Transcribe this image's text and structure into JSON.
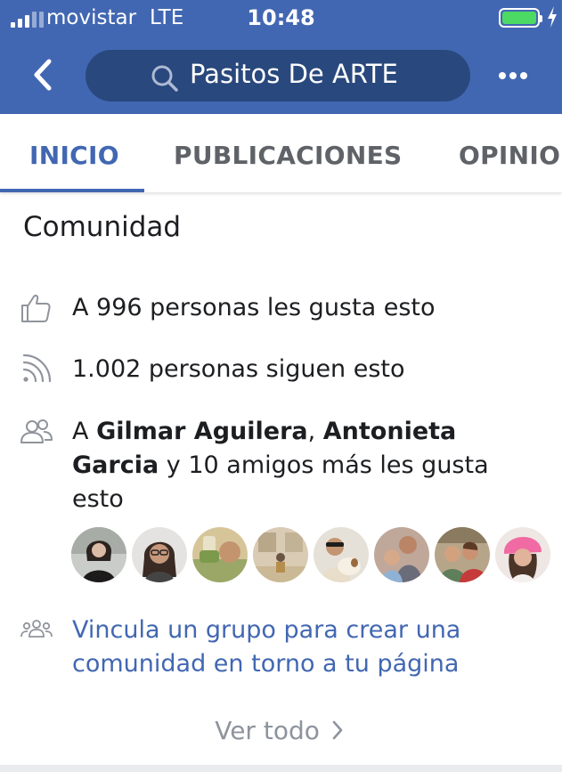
{
  "status_bar": {
    "carrier": "movistar",
    "network": "LTE",
    "time": "10:48"
  },
  "nav": {
    "search_text": "Pasitos De ARTE"
  },
  "tabs": [
    {
      "label": "INICIO",
      "active": true
    },
    {
      "label": "PUBLICACIONES",
      "active": false
    },
    {
      "label": "OPINIONES",
      "active": false
    }
  ],
  "community": {
    "title": "Comunidad",
    "likes": "A 996 personas les gusta esto",
    "follows": "1.002 personas siguen esto",
    "friends": {
      "prefix": "A ",
      "friend1": "Gilmar Aguilera",
      "sep": ", ",
      "friend2": "Antonieta Garcia",
      "suffix": " y 10 amigos más les gusta esto"
    },
    "link_group": "Vincula un grupo para crear una comunidad en torno a tu página",
    "see_all": "Ver todo"
  },
  "colors": {
    "brand": "#4267b2",
    "search_bg": "#29487d",
    "battery": "#4cd964"
  },
  "icons": [
    "back-chevron-icon",
    "search-icon",
    "more-dots-icon",
    "thumbs-up-icon",
    "rss-follow-icon",
    "friends-icon",
    "group-icon",
    "chevron-right-icon"
  ]
}
